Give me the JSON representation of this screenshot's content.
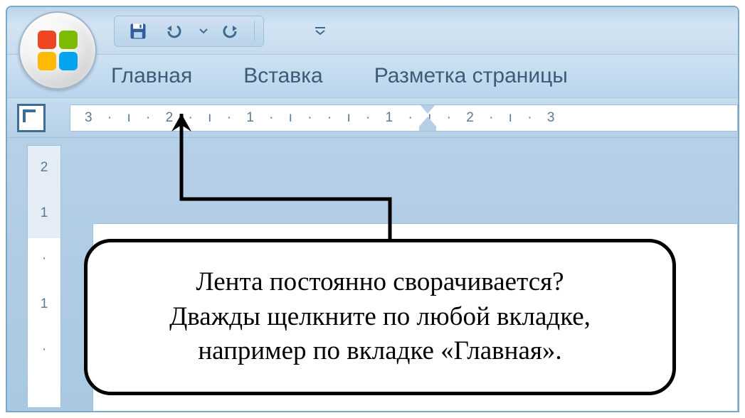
{
  "qat": {
    "save_icon": "save-icon",
    "undo_icon": "undo-icon",
    "redo_icon": "redo-icon"
  },
  "tabs": {
    "home": "Главная",
    "insert": "Вставка",
    "page_layout": "Разметка страницы"
  },
  "ruler": {
    "h_units": "3 · ı · 2 · ı · 1 · ı ·   · ı · 1 · ı · 2 · ı · 3",
    "v_units": [
      "2",
      "1",
      "·",
      "1",
      "·"
    ]
  },
  "callout": {
    "line1": "Лента постоянно сворачивается?",
    "line2": "Дважды щелкните по любой вкладке,",
    "line3": "например по вкладке «Главная»."
  }
}
